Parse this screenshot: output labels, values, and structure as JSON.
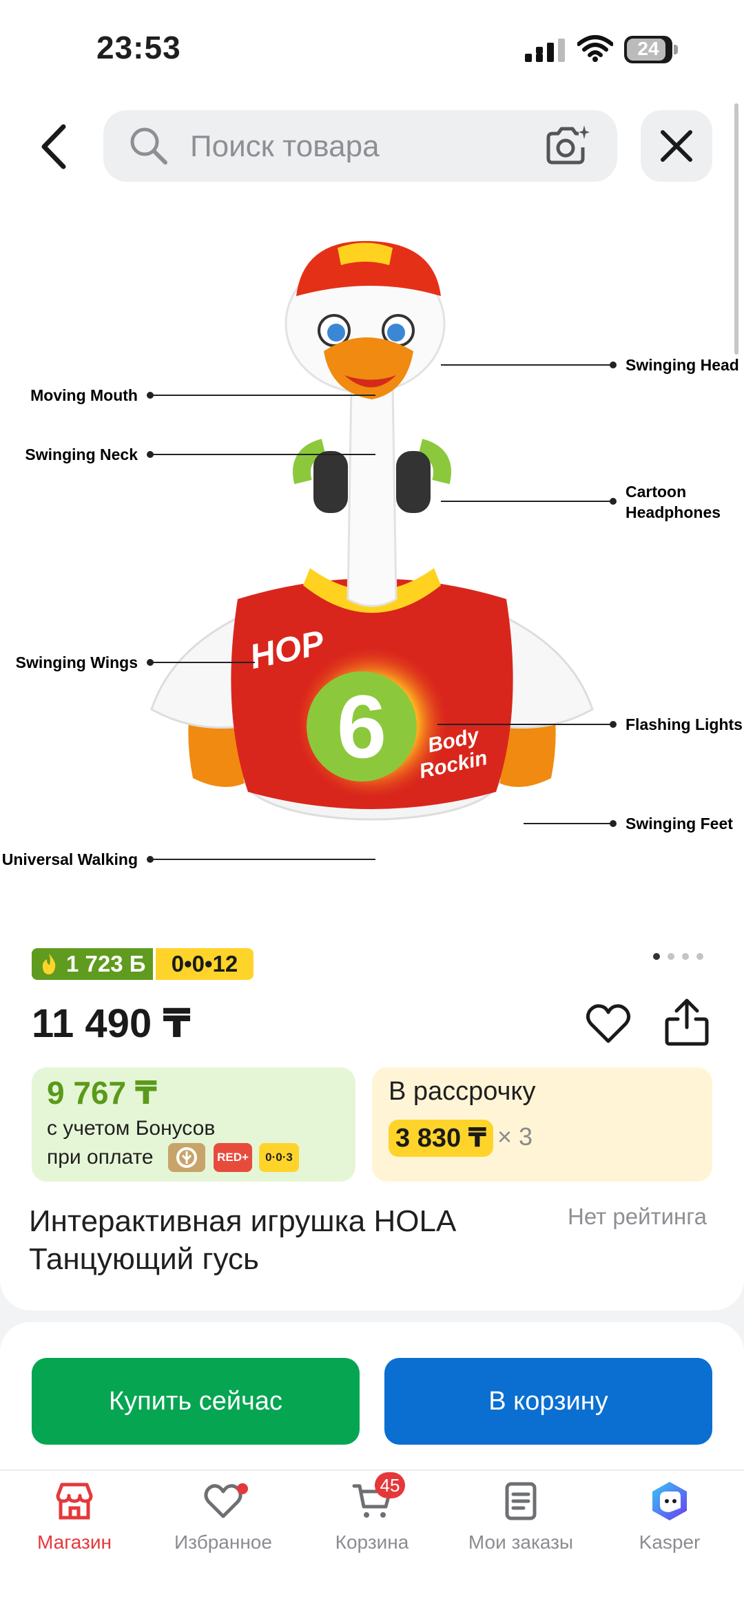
{
  "status_bar": {
    "time": "23:53",
    "battery": "24"
  },
  "search": {
    "placeholder": "Поиск товара"
  },
  "product_image": {
    "callouts": {
      "swinging_head": "Swinging Head",
      "moving_mouth": "Moving Mouth",
      "swinging_neck": "Swinging Neck",
      "cartoon_headphones_1": "Cartoon",
      "cartoon_headphones_2": "Headphones",
      "swinging_wings": "Swinging Wings",
      "flashing_lights": "Flashing Lights",
      "swinging_feet": "Swinging Feet",
      "universal_walking": "Universal Walking"
    },
    "toy_text": {
      "hop": "HOP",
      "number": "6",
      "body_1": "Body",
      "body_2": "Rockin"
    },
    "gallery_pages": 4,
    "gallery_current": 1
  },
  "badges": {
    "bonus": "1 723 Б",
    "installment": "0•0•12"
  },
  "price": {
    "main": "11 490 ₸"
  },
  "bonus_card": {
    "price": "9 767 ₸",
    "line1": "с учетом Бонусов",
    "line2": "при оплате",
    "chips": {
      "red": "RED+",
      "zero": "0·0·3"
    }
  },
  "rassrochka_card": {
    "title": "В рассрочку",
    "amount": "3 830 ₸",
    "multiplier": "× 3"
  },
  "product": {
    "title": "Интерактивная игрушка HOLA Танцующий гусь",
    "rating": "Нет рейтинга"
  },
  "actions": {
    "buy_now": "Купить сейчас",
    "add_to_cart": "В корзину"
  },
  "tabs": [
    {
      "label": "Магазин",
      "icon": "shop-icon",
      "active": true
    },
    {
      "label": "Избранное",
      "icon": "heart-icon"
    },
    {
      "label": "Корзина",
      "icon": "cart-icon",
      "badge": "45"
    },
    {
      "label": "Мои заказы",
      "icon": "orders-icon"
    },
    {
      "label": "Kasper",
      "icon": "kasper-icon"
    }
  ],
  "colors": {
    "accent_red": "#e5383b",
    "buy_green": "#06a552",
    "cart_blue": "#0a6fd1",
    "installment_yellow": "#ffd42a",
    "bonus_green": "#5f9b1e"
  }
}
